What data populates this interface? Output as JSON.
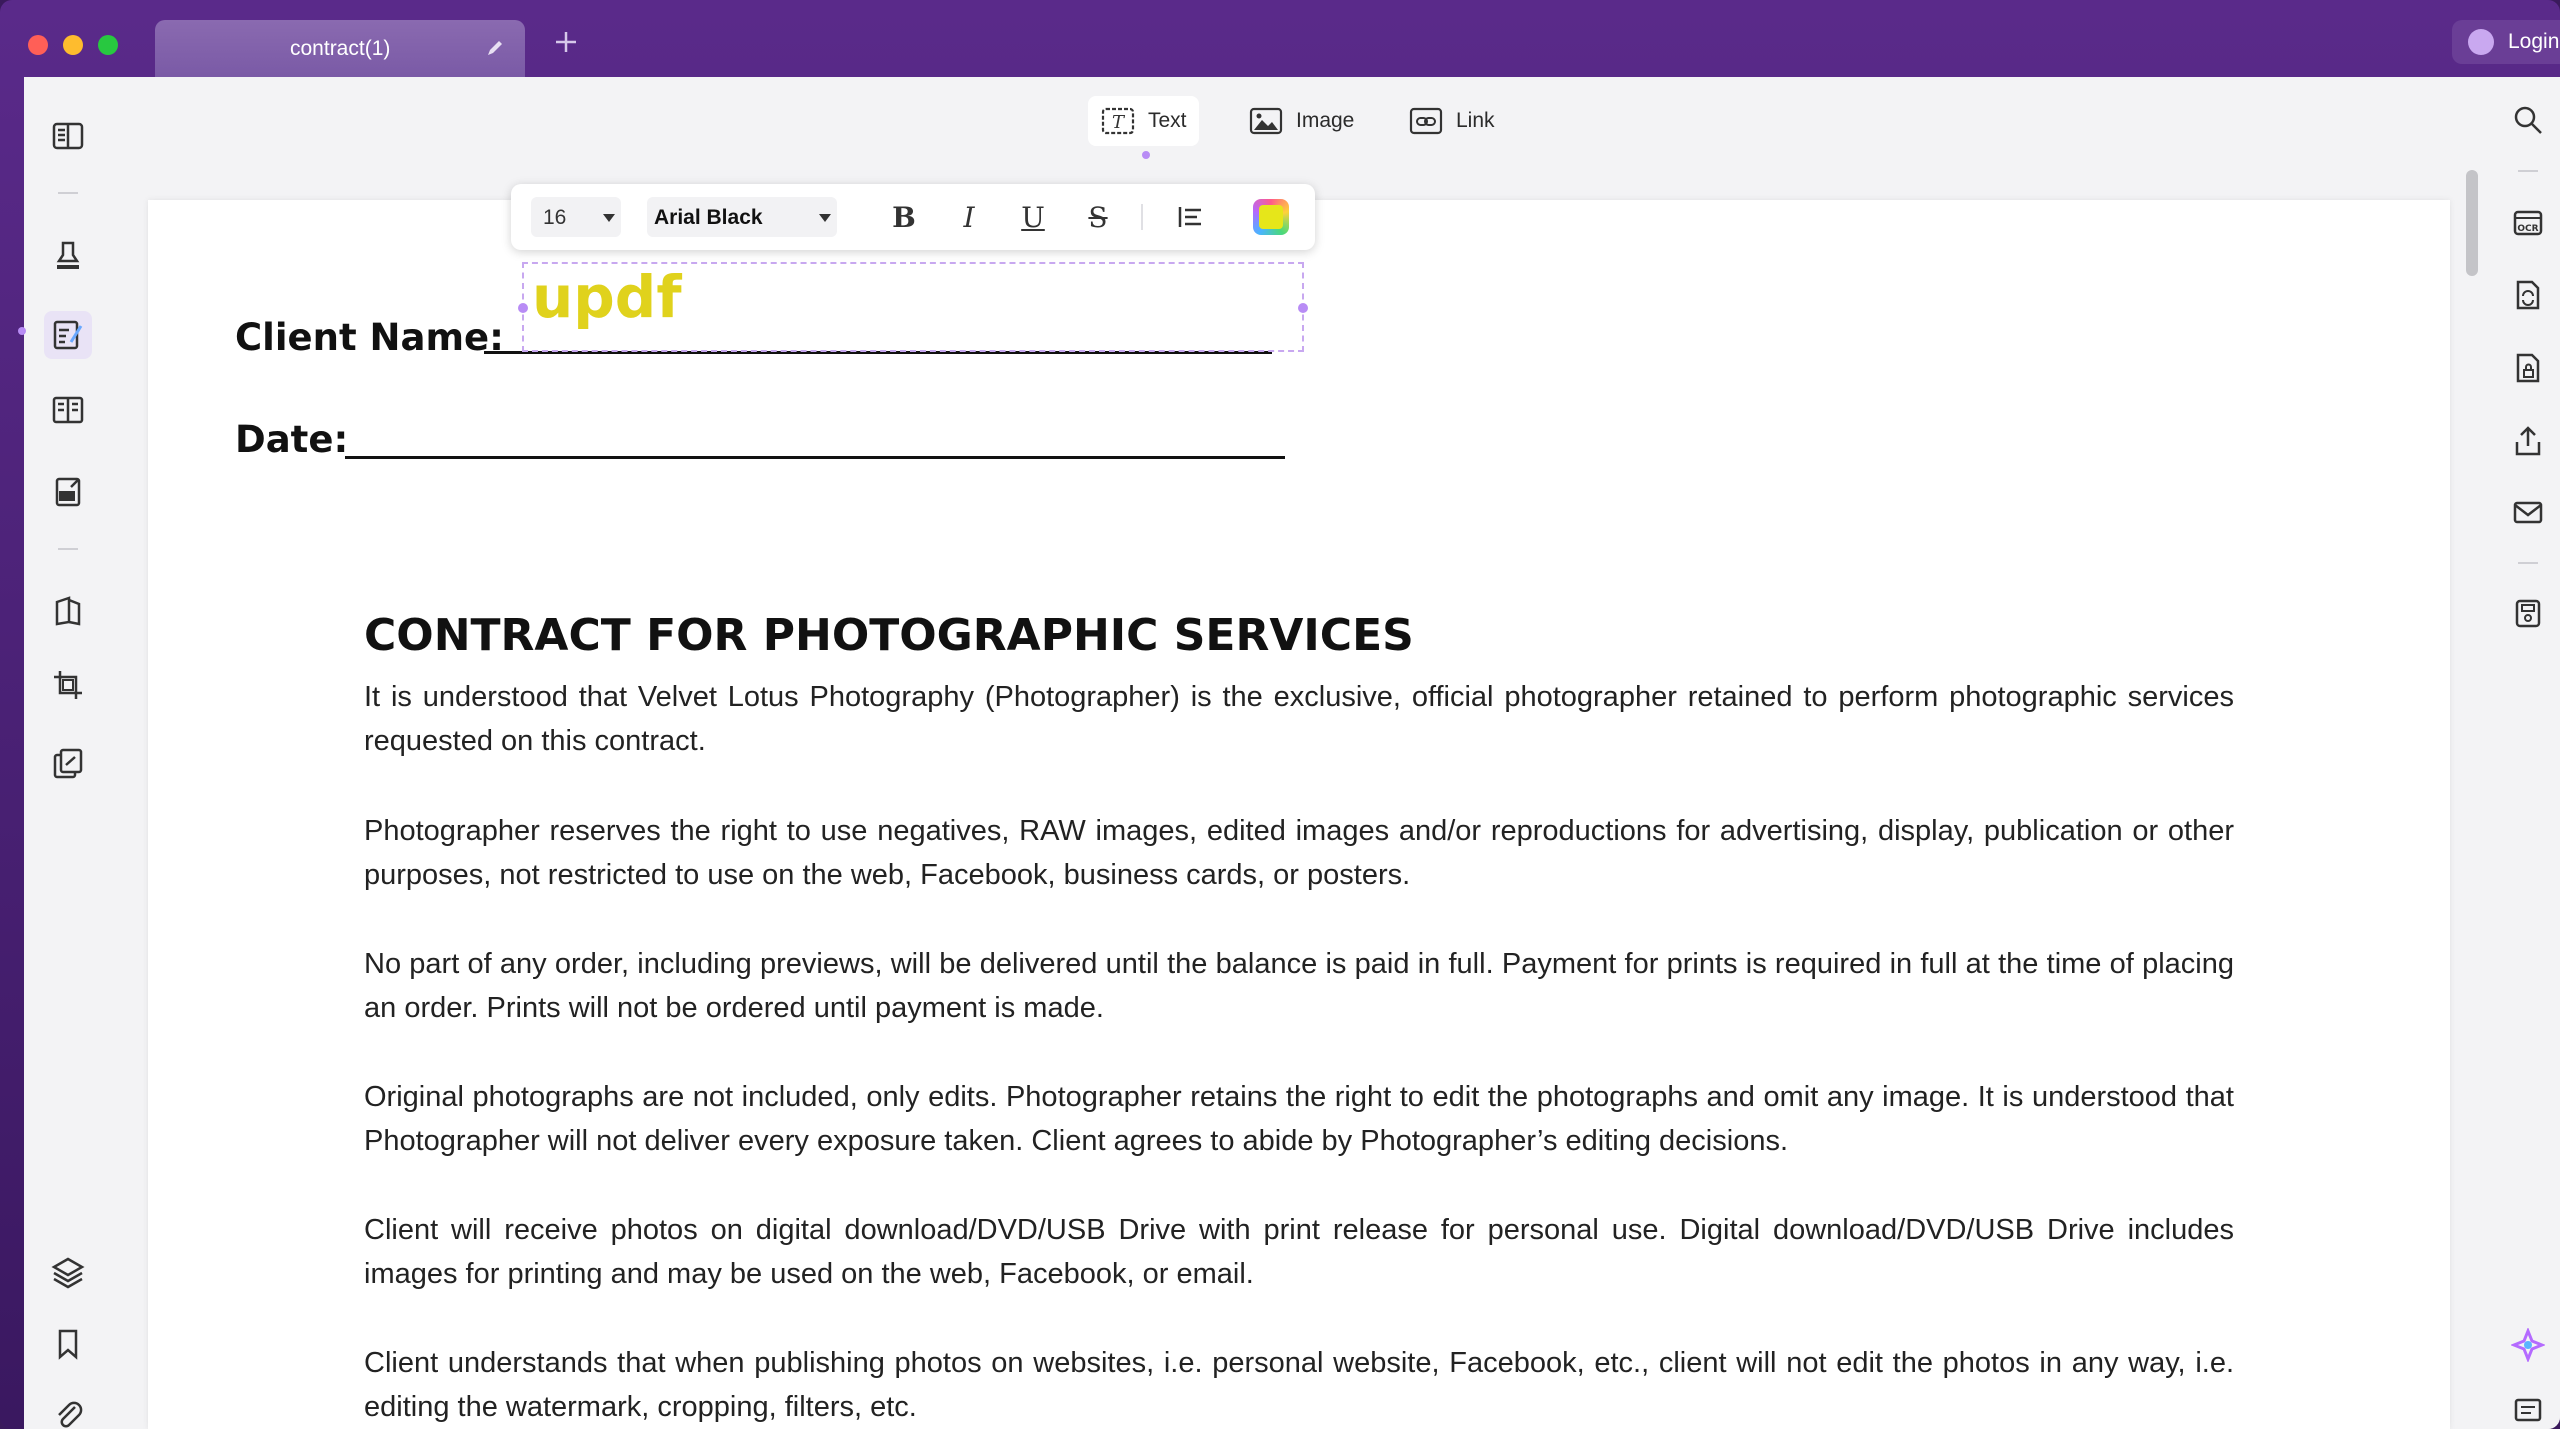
{
  "titlebar": {
    "tab_label": "contract(1)",
    "login_label": "Login"
  },
  "modes": {
    "text": "Text",
    "image": "Image",
    "link": "Link",
    "active": "Text"
  },
  "format_bar": {
    "font_size": "16",
    "font_family": "Arial Black",
    "text_color": "#e6e61a"
  },
  "editing_text": "updf",
  "fields": {
    "client_name": "Client Name:",
    "date": "Date:"
  },
  "document": {
    "title": "CONTRACT FOR PHOTOGRAPHIC SERVICES",
    "paragraphs": [
      "It is understood that Velvet Lotus Photography (Photographer) is the exclusive, official photographer retained to perform photographic services requested on this contract.",
      "Photographer reserves the right to use negatives, RAW images, edited images and/or reproductions for advertising, display, publication or other purposes, not restricted to use on the web, Facebook, business cards, or posters.",
      "No part of any order, including previews, will be delivered until the balance is paid in full. Payment for prints is required in full at the time of placing an order. Prints will not be ordered until payment is made.",
      "Original photographs are not included, only edits. Photographer retains the right to edit the photographs and omit any image. It is understood that Photographer will not deliver every exposure taken. Client agrees to abide by Photographer’s editing decisions.",
      "Client will receive photos on digital download/DVD/USB Drive with print release for personal use. Digital download/DVD/USB Drive includes images for printing and may be used on the web, Facebook, or email.",
      "Client understands that when publishing photos on websites, i.e. personal website, Facebook, etc., client will not edit the photos in any way, i.e. editing the watermark, cropping, filters, etc."
    ]
  },
  "colors": {
    "accent": "#b88cf5",
    "titlebar": "#5a2a8a",
    "text_highlight": "#e0d21c"
  }
}
